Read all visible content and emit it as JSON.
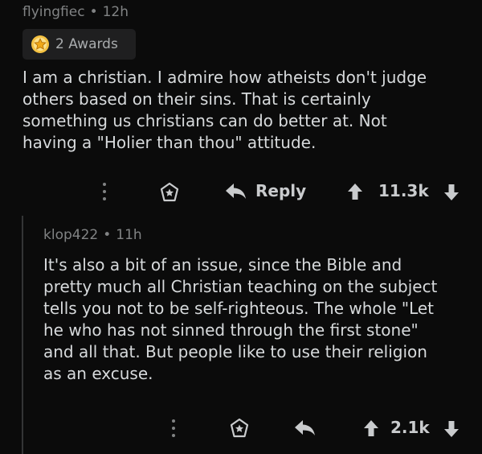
{
  "parent": {
    "username": "flyingfiec",
    "separator": "•",
    "timestamp": "12h",
    "awards_label": "2 Awards",
    "body": "I am a christian. I admire how atheists don't judge\nothers based on their sins. That is certainly\nsomething us christians can do better at. Not\nhaving a \"Holier than thou\" attitude.",
    "reply_label": "Reply",
    "score": "11.3k"
  },
  "reply": {
    "username": "klop422",
    "separator": "•",
    "timestamp": "11h",
    "body": "It's also a bit of an issue, since the Bible and\npretty much all Christian teaching on the subject\ntells you not to be self-righteous. The whole \"Let\nhe who has not sinned through the first stone\"\nand all that. But people like to use their religion\nas an excuse.",
    "score": "2.1k"
  },
  "colors": {
    "background": "#0b0b0b",
    "text": "#d7dadc",
    "muted": "#818384",
    "award_gold": "#f5c242"
  },
  "icons": [
    "award-badge-icon",
    "more-options-icon",
    "award-icon",
    "reply-arrow-icon",
    "upvote-arrow-icon",
    "downvote-arrow-icon"
  ]
}
